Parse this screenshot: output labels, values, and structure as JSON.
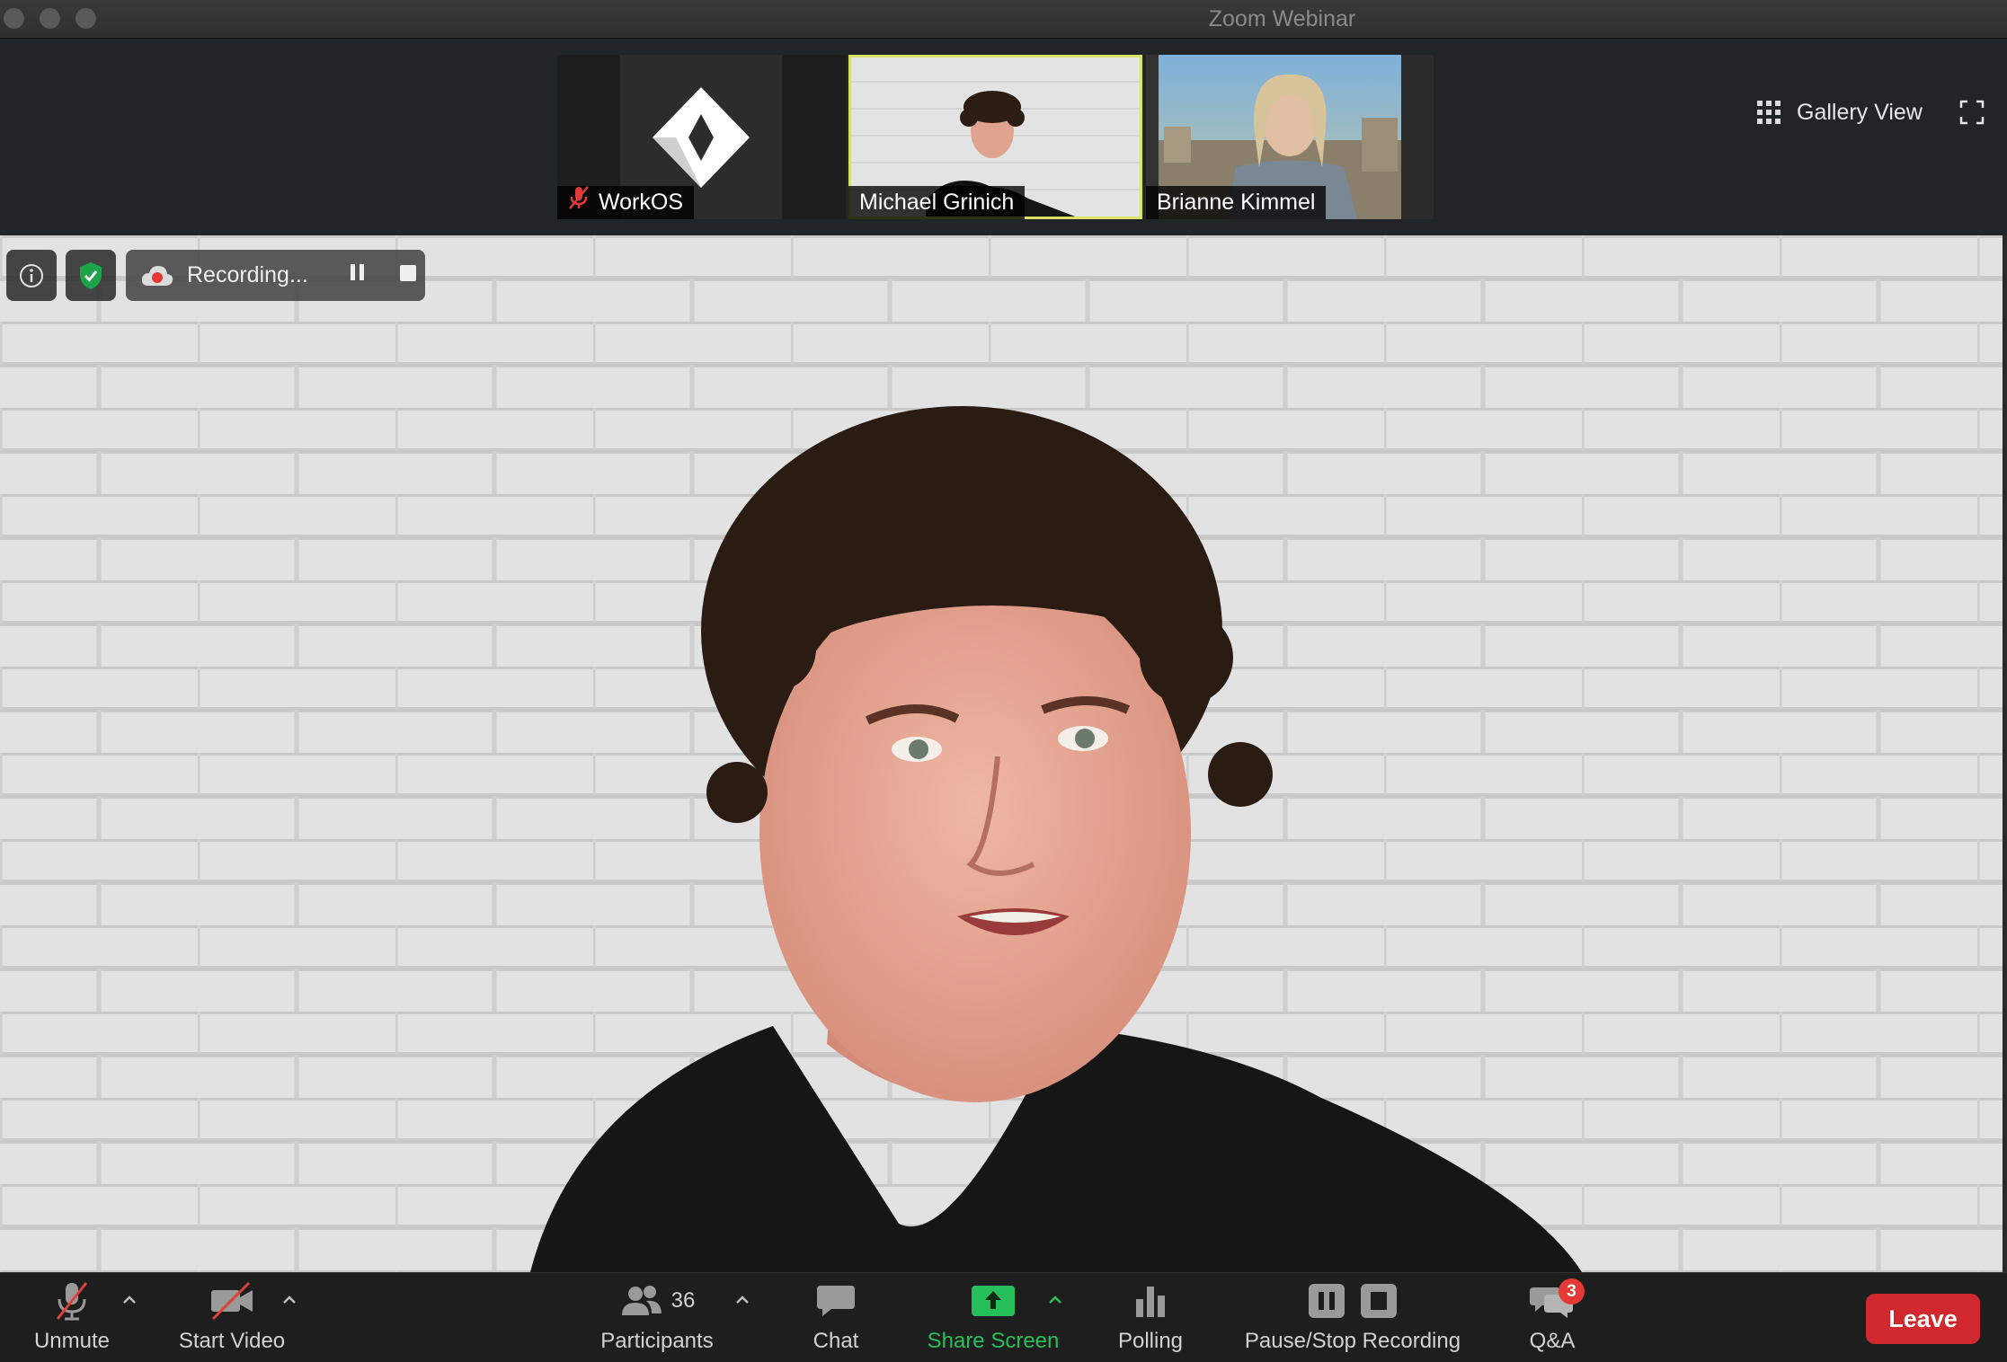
{
  "window": {
    "title": "Zoom Webinar"
  },
  "gallery": {
    "view_label": "Gallery View",
    "participants": [
      {
        "name": "WorkOS",
        "muted": true
      },
      {
        "name": "Michael Grinich",
        "muted": false,
        "active_speaker": true
      },
      {
        "name": "Brianne Kimmel",
        "muted": false
      }
    ]
  },
  "recording": {
    "status": "Recording..."
  },
  "toolbar": {
    "unmute_label": "Unmute",
    "start_video_label": "Start Video",
    "participants_label": "Participants",
    "participants_count": "36",
    "chat_label": "Chat",
    "share_screen_label": "Share Screen",
    "polling_label": "Polling",
    "pause_stop_recording_label": "Pause/Stop Recording",
    "qa_label": "Q&A",
    "qa_badge": "3",
    "leave_label": "Leave"
  },
  "colors": {
    "active_speaker_border": "#d9e36a",
    "share_green": "#26c05a",
    "leave_red": "#d0282e",
    "shield_green": "#1fa34a",
    "badge_red": "#e53935"
  }
}
